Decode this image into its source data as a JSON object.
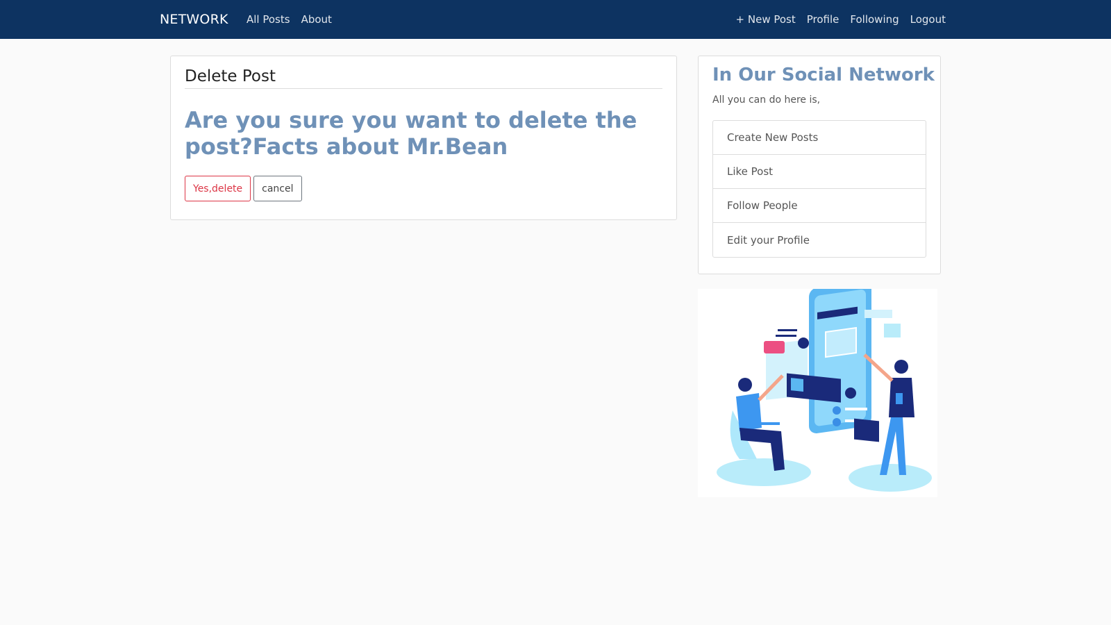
{
  "navbar": {
    "brand": "NETWORK",
    "left_links": [
      "All Posts",
      "About"
    ],
    "right_links": [
      "+ New Post",
      "Profile",
      "Following",
      "Logout"
    ]
  },
  "delete_card": {
    "title": "Delete Post",
    "message": "Are you sure you want to delete the post?Facts about Mr.Bean",
    "confirm_label": "Yes,delete",
    "cancel_label": "cancel"
  },
  "sidebar": {
    "title": "In Our Social Network",
    "subtitle": "All you can do here is,",
    "items": [
      "Create New Posts",
      "Like Post",
      "Follow People",
      "Edit your Profile"
    ]
  },
  "illustration": {
    "icon": "social-network-illustration"
  },
  "colors": {
    "navbar": "#0d3361",
    "heading_accent": "#6f91b7",
    "danger": "#dc3545",
    "background": "#fafafa"
  }
}
